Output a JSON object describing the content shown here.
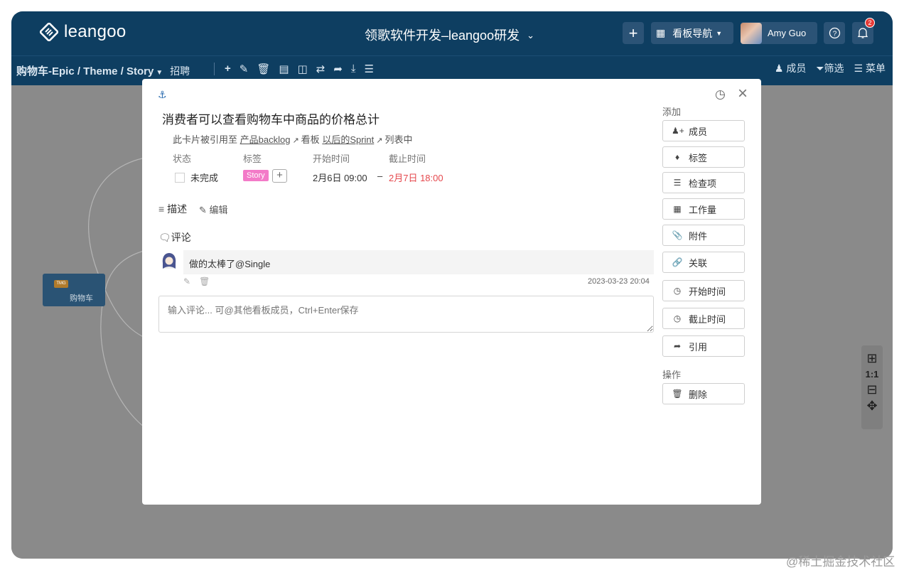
{
  "header": {
    "logo_text": "leangoo",
    "board_title": "领歌软件开发–leangoo研发",
    "board_nav_label": "看板导航",
    "user_name": "Amy Guo",
    "notification_count": "2"
  },
  "subbar": {
    "breadcrumb": "购物车-Epic / Theme / Story",
    "recruit": "招聘",
    "members": "成员",
    "filter": "筛选",
    "menu": "菜单"
  },
  "canvas": {
    "node_tag": "TMG",
    "node_label": "购物车",
    "zoom_label": "1:1"
  },
  "card": {
    "title": "消费者可以查看购物车中商品的价格总计",
    "ref_prefix": "此卡片被引用至",
    "ref_link1": "产品backlog",
    "ref_mid": "看板",
    "ref_link2": "以后的Sprint",
    "ref_suffix": "列表中",
    "status_header": "状态",
    "tag_header": "标签",
    "start_header": "开始时间",
    "due_header": "截止时间",
    "status_value": "未完成",
    "tag_value": "Story",
    "start_value": "2月6日 09:00",
    "range_sep": "–",
    "due_value": "2月7日 18:00",
    "due_color": "#e5484d",
    "describe_label": "描述",
    "edit_label": "编辑",
    "comment_label": "评论",
    "comment_text": "做的太棒了@Single",
    "comment_time": "2023-03-23 20:04",
    "comment_placeholder": "输入评论... 可@其他看板成员，Ctrl+Enter保存"
  },
  "sidebar": {
    "add_label": "添加",
    "buttons": [
      "成员",
      "标签",
      "检查项",
      "工作量",
      "附件",
      "关联",
      "开始时间",
      "截止时间",
      "引用"
    ],
    "ops_label": "操作",
    "delete": "删除"
  },
  "watermark": "@稀土掘金技术社区"
}
